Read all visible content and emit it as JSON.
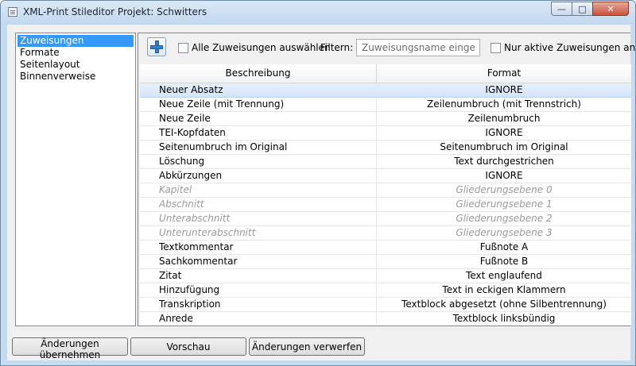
{
  "window": {
    "title": "XML-Print Stileditor Projekt: Schwitters"
  },
  "nav": {
    "items": [
      {
        "label": "Zuweisungen",
        "selected": true
      },
      {
        "label": "Formate",
        "selected": false
      },
      {
        "label": "Seitenlayout",
        "selected": false
      },
      {
        "label": "Binnenverweise",
        "selected": false
      }
    ]
  },
  "toolbar": {
    "add_icon": "plus-icon",
    "select_all_label": "Alle Zuweisungen auswählen",
    "filter_label": "Filtern:",
    "filter_placeholder": "Zuweisungsname eingeben",
    "active_only_label": "Nur aktive Zuweisungen anz"
  },
  "table": {
    "columns": [
      "Beschreibung",
      "Format"
    ],
    "rows": [
      {
        "beschreibung": "Neuer Absatz",
        "format": "IGNORE",
        "active": true,
        "selected": true
      },
      {
        "beschreibung": "Neue Zeile (mit Trennung)",
        "format": "Zeilenumbruch (mit Trennstrich)",
        "active": true
      },
      {
        "beschreibung": "Neue Zeile",
        "format": "Zeilenumbruch",
        "active": true
      },
      {
        "beschreibung": "TEI-Kopfdaten",
        "format": "IGNORE",
        "active": true
      },
      {
        "beschreibung": "Seitenumbruch im Original",
        "format": "Seitenumbruch im Original",
        "active": true
      },
      {
        "beschreibung": "Löschung",
        "format": "Text durchgestrichen",
        "active": true
      },
      {
        "beschreibung": "Abkürzungen",
        "format": "IGNORE",
        "active": true
      },
      {
        "beschreibung": "Kapitel",
        "format": "Gliederungsebene 0",
        "active": false
      },
      {
        "beschreibung": "Abschnitt",
        "format": "Gliederungsebene 1",
        "active": false
      },
      {
        "beschreibung": "Unterabschnitt",
        "format": "Gliederungsebene 2",
        "active": false
      },
      {
        "beschreibung": "Unterunterabschnitt",
        "format": "Gliederungsebene 3",
        "active": false
      },
      {
        "beschreibung": "Textkommentar",
        "format": "Fußnote A",
        "active": true
      },
      {
        "beschreibung": "Sachkommentar",
        "format": "Fußnote B",
        "active": true
      },
      {
        "beschreibung": "Zitat",
        "format": "Text englaufend",
        "active": true
      },
      {
        "beschreibung": "Hinzufügung",
        "format": "Text in eckigen Klammern",
        "active": true
      },
      {
        "beschreibung": "Transkription",
        "format": "Textblock abgesetzt (ohne Silbentrennung)",
        "active": true
      },
      {
        "beschreibung": "Anrede",
        "format": "Textblock linksbündig",
        "active": true
      }
    ]
  },
  "buttons": {
    "apply": "Änderungen übernehmen",
    "preview": "Vorschau",
    "discard": "Änderungen verwerfen"
  }
}
